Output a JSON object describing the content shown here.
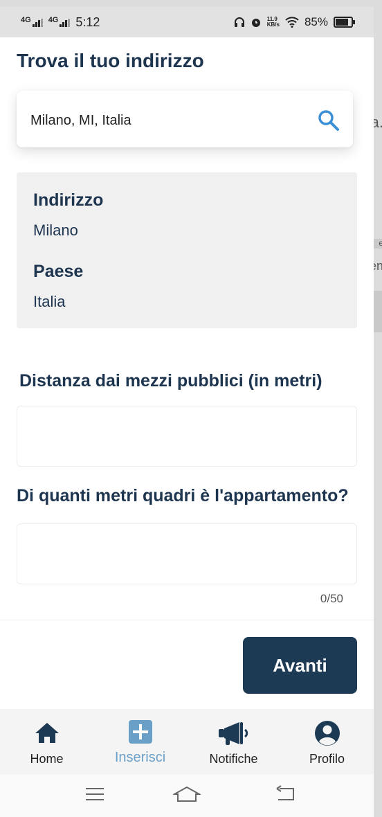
{
  "status_bar": {
    "network_1": "4G",
    "network_2": "4G",
    "time": "5:12",
    "speed_value": "11.9",
    "speed_unit": "KB/s",
    "battery": "85%",
    "icons": [
      "headphones-icon",
      "alarm-icon",
      "wifi-icon",
      "battery-icon"
    ]
  },
  "background_peek": [
    "a.",
    "e",
    "en"
  ],
  "page": {
    "title": "Trova il tuo indirizzo"
  },
  "search": {
    "value": "Milano, MI, Italia",
    "icon": "search-icon"
  },
  "address_info": {
    "address_label": "Indirizzo",
    "address_value": "Milano",
    "country_label": "Paese",
    "country_value": "Italia"
  },
  "fields": {
    "distance_label": "Distanza dai mezzi pubblici (in metri)",
    "distance_value": "",
    "area_label": "Di quanti metri quadri è l'appartamento?",
    "area_value": "",
    "area_counter": "0/50"
  },
  "actions": {
    "next_label": "Avanti"
  },
  "bottom_nav": {
    "items": [
      {
        "label": "Home",
        "icon": "home-icon",
        "active": false
      },
      {
        "label": "Inserisci",
        "icon": "add-icon",
        "active": true
      },
      {
        "label": "Notifiche",
        "icon": "megaphone-icon",
        "active": false
      },
      {
        "label": "Profilo",
        "icon": "profile-icon",
        "active": false
      }
    ]
  },
  "colors": {
    "primary": "#1d3a54",
    "heading": "#1e3550",
    "accent_active": "#6aa0c8",
    "search_icon": "#3a8fd6"
  }
}
